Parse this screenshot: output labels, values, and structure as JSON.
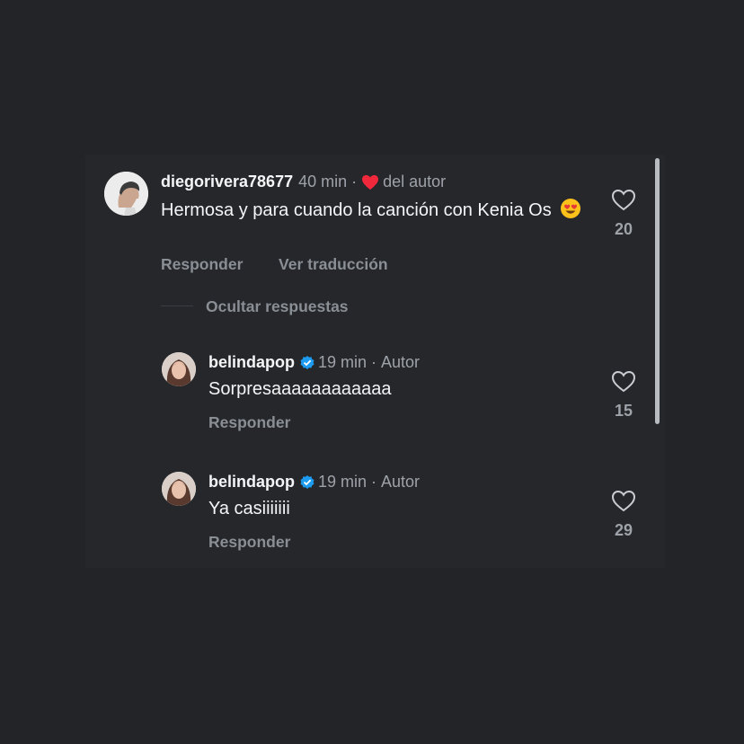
{
  "comments": [
    {
      "username": "diegorivera78677",
      "time": "40 min",
      "separator": "·",
      "author_badge": "del autor",
      "text": "Hermosa y para cuando la canción con Kenia Os",
      "emoji": "heart-eyes-emoji",
      "reply_label": "Responder",
      "translate_label": "Ver traducción",
      "likes": "20"
    }
  ],
  "replies_toggle": "Ocultar respuestas",
  "replies": [
    {
      "username": "belindapop",
      "time": "19 min",
      "separator": "·",
      "author_label": "Autor",
      "text": "Sorpresaaaaaaaaaaaa",
      "reply_label": "Responder",
      "likes": "15"
    },
    {
      "username": "belindapop",
      "time": "19 min",
      "separator": "·",
      "author_label": "Autor",
      "text": "Ya casiiiiiii",
      "reply_label": "Responder",
      "likes": "29"
    }
  ],
  "colors": {
    "background": "#222428",
    "liked_heart": "#f0283c",
    "verified": "#1d9bf0",
    "muted_text": "#9ea2a9"
  }
}
